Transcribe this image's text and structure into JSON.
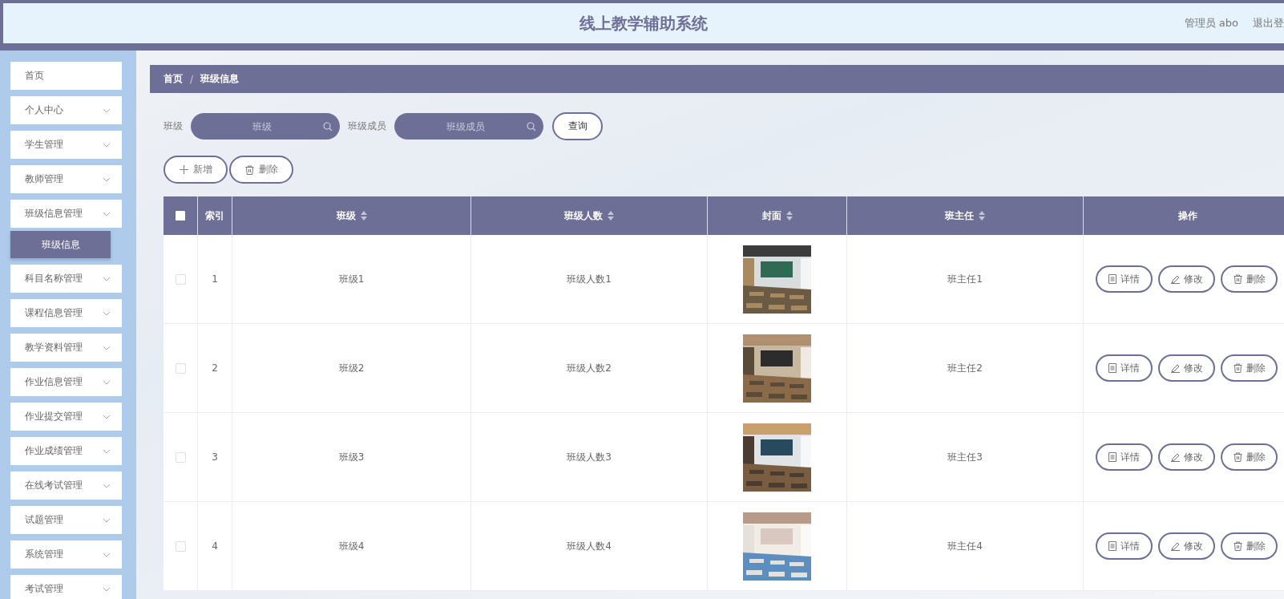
{
  "header": {
    "title": "线上教学辅助系统",
    "user": "管理员 abo",
    "logout": "退出登"
  },
  "sidebar": {
    "items": [
      {
        "label": "首页",
        "kind": "link"
      },
      {
        "label": "个人中心",
        "kind": "menu"
      },
      {
        "label": "学生管理",
        "kind": "menu"
      },
      {
        "label": "教师管理",
        "kind": "menu"
      },
      {
        "label": "班级信息管理",
        "kind": "menu",
        "children": [
          {
            "label": "班级信息",
            "selected": true
          }
        ]
      },
      {
        "label": "科目名称管理",
        "kind": "menu"
      },
      {
        "label": "课程信息管理",
        "kind": "menu"
      },
      {
        "label": "教学资料管理",
        "kind": "menu"
      },
      {
        "label": "作业信息管理",
        "kind": "menu"
      },
      {
        "label": "作业提交管理",
        "kind": "menu"
      },
      {
        "label": "作业成绩管理",
        "kind": "menu"
      },
      {
        "label": "在线考试管理",
        "kind": "menu"
      },
      {
        "label": "试题管理",
        "kind": "menu"
      },
      {
        "label": "系统管理",
        "kind": "menu"
      },
      {
        "label": "考试管理",
        "kind": "menu"
      }
    ]
  },
  "breadcrumb": {
    "items": [
      "首页",
      "班级信息"
    ],
    "separator": "/"
  },
  "search": {
    "fields": [
      {
        "label": "班级",
        "placeholder": "班级"
      },
      {
        "label": "班级成员",
        "placeholder": "班级成员"
      }
    ],
    "button": "查询"
  },
  "toolbar": {
    "add": "新增",
    "delete": "删除"
  },
  "table": {
    "select_all": {
      "checked": false
    },
    "columns": [
      {
        "label": "索引",
        "sortable": false
      },
      {
        "label": "班级",
        "sortable": true
      },
      {
        "label": "班级人数",
        "sortable": true
      },
      {
        "label": "封面",
        "sortable": true
      },
      {
        "label": "班主任",
        "sortable": true
      },
      {
        "label": "操作",
        "sortable": false
      }
    ],
    "rows": [
      {
        "selected": false,
        "index": "1",
        "class": "班级1",
        "count": "班级人数1",
        "cover": {
          "kind": "picture"
        },
        "teacher": "班主任1",
        "actions": [
          "详情",
          "修改",
          "删除"
        ]
      },
      {
        "selected": false,
        "index": "2",
        "class": "班级2",
        "count": "班级人数2",
        "cover": {
          "kind": "picture"
        },
        "teacher": "班主任2",
        "actions": [
          "详情",
          "修改",
          "删除"
        ]
      },
      {
        "selected": false,
        "index": "3",
        "class": "班级3",
        "count": "班级人数3",
        "cover": {
          "kind": "picture"
        },
        "teacher": "班主任3",
        "actions": [
          "详情",
          "修改",
          "删除"
        ]
      },
      {
        "selected": false,
        "index": "4",
        "class": "班级4",
        "count": "班级人数4",
        "cover": {
          "kind": "picture"
        },
        "teacher": "班主任4",
        "actions": [
          "详情",
          "修改",
          "删除"
        ]
      }
    ]
  }
}
